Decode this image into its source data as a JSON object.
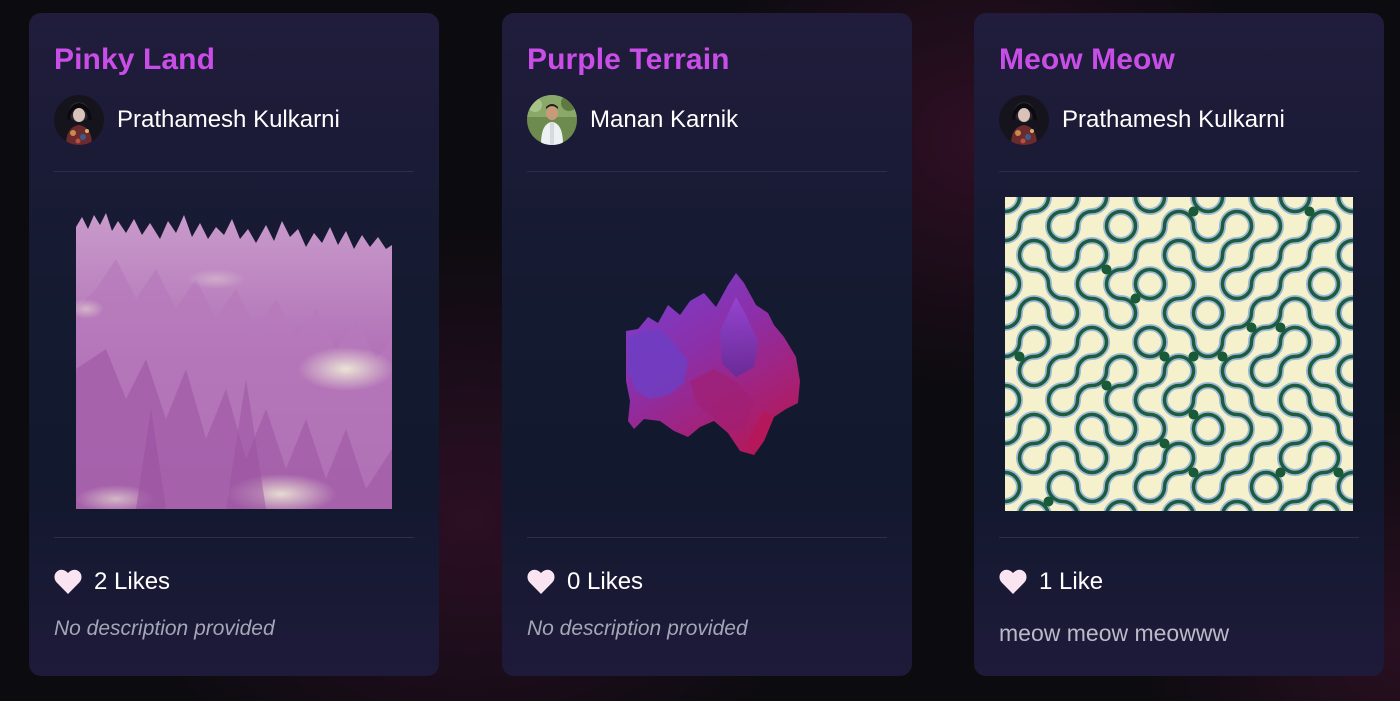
{
  "cards": [
    {
      "title": "Pinky Land",
      "author": "Prathamesh Kulkarni",
      "likes": "2 Likes",
      "description": "No description provided"
    },
    {
      "title": "Purple Terrain",
      "author": "Manan Karnik",
      "likes": "0 Likes",
      "description": "No description provided"
    },
    {
      "title": "Meow Meow",
      "author": "Prathamesh Kulkarni",
      "likes": "1 Like",
      "description": "meow meow meowww"
    }
  ],
  "colors": {
    "title": "#c94ee8",
    "card_background": "#161b33",
    "heart": "#fbe4f2",
    "description": "#a4a7b7"
  },
  "icons": {
    "like": "heart-icon",
    "avatar": "user-avatar"
  }
}
